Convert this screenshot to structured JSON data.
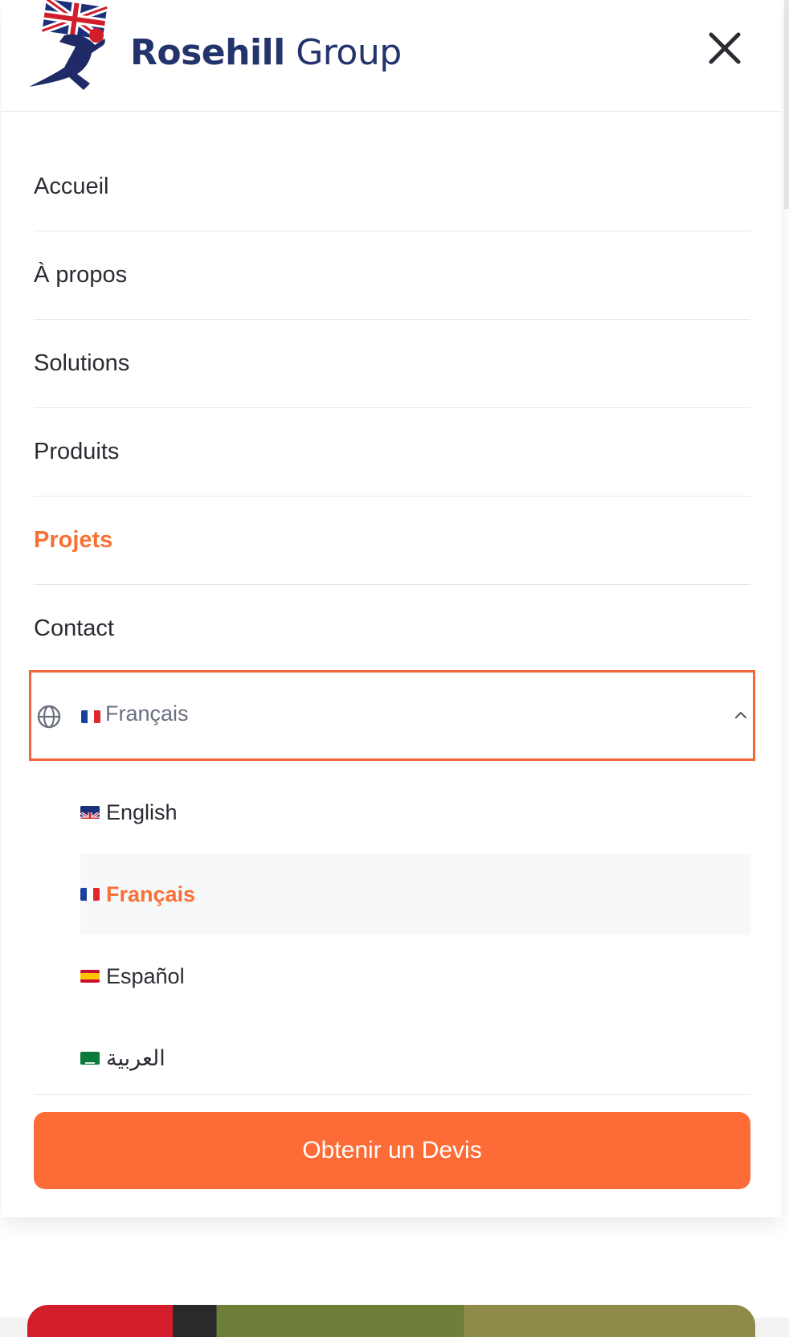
{
  "header": {
    "logo_bold": "Rosehill",
    "logo_light": " Group",
    "close_icon": "close-icon"
  },
  "nav": {
    "items": [
      {
        "label": "Accueil",
        "active": false
      },
      {
        "label": "À propos",
        "active": false
      },
      {
        "label": "Solutions",
        "active": false
      },
      {
        "label": "Produits",
        "active": false
      },
      {
        "label": "Projets",
        "active": true
      },
      {
        "label": "Contact",
        "active": false
      }
    ]
  },
  "language": {
    "current": "Français",
    "icon": "globe-icon",
    "options": [
      {
        "label": "English",
        "flag": "uk-flag-icon"
      },
      {
        "label": "Français",
        "flag": "fr-flag-icon",
        "selected": true
      },
      {
        "label": "Español",
        "flag": "es-flag-icon"
      },
      {
        "label": "العربية",
        "flag": "sa-flag-icon"
      }
    ]
  },
  "cta": {
    "label": "Obtenir un Devis"
  },
  "colors": {
    "accent": "#fd6c36",
    "brand": "#23336b",
    "text": "#2b2b33"
  }
}
